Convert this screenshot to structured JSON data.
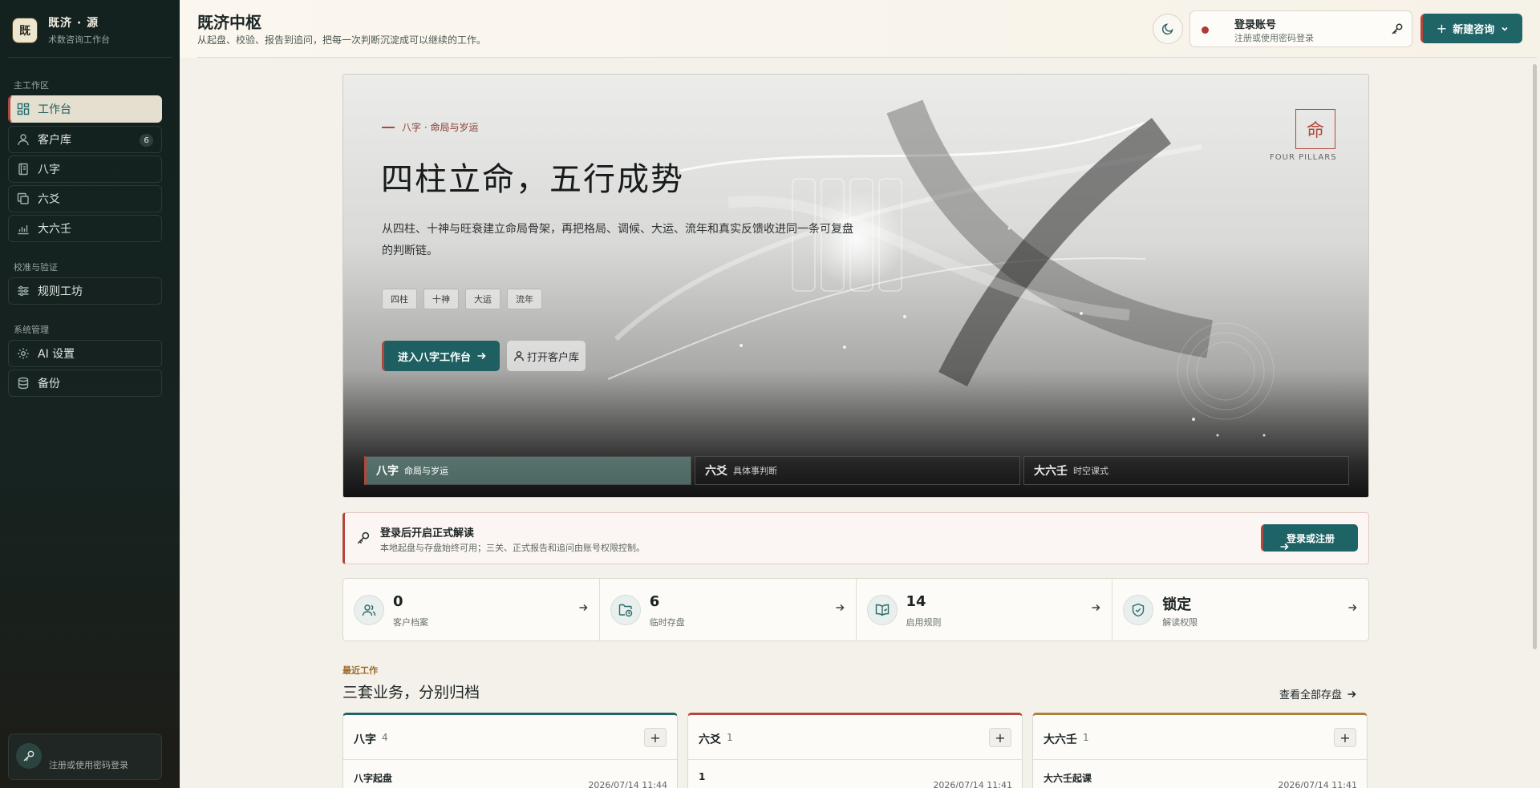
{
  "brand": {
    "logo_char": "既",
    "title": "既济 · 源",
    "subtitle": "术数咨询工作台"
  },
  "sidebar": {
    "sections": [
      {
        "label": "主工作区"
      },
      {
        "label": "校准与验证"
      },
      {
        "label": "系统管理"
      }
    ],
    "items": [
      {
        "label": "工作台",
        "icon": "dashboard-icon"
      },
      {
        "label": "客户库",
        "icon": "user-icon",
        "badge": "6"
      },
      {
        "label": "八字",
        "icon": "book-icon"
      },
      {
        "label": "六爻",
        "icon": "copy-icon"
      },
      {
        "label": "大六壬",
        "icon": "chart-icon"
      },
      {
        "label": "规则工坊",
        "icon": "sliders-icon"
      },
      {
        "label": "AI 设置",
        "icon": "gear-icon"
      },
      {
        "label": "备份",
        "icon": "database-icon"
      }
    ],
    "login_hint": "注册或使用密码登录"
  },
  "header": {
    "title": "既济中枢",
    "subtitle": "从起盘、校验、报告到追问，把每一次判断沉淀成可以继续的工作。",
    "account_title": "登录账号",
    "account_sub": "注册或使用密码登录",
    "new_button": "新建咨询",
    "new_button_plus": "+"
  },
  "hero": {
    "tag": "八字 · 命局与岁运",
    "title": "四柱立命，五行成势",
    "description": "从四柱、十神与旺衰建立命局骨架，再把格局、调候、大运、流年和真实反馈收进同一条可复盘的判断链。",
    "chips": [
      "四柱",
      "十神",
      "大运",
      "流年"
    ],
    "primary_button": "进入八字工作台",
    "secondary_button": "打开客户库",
    "seal_char": "命",
    "seal_caption": "FOUR PILLARS",
    "tabs": [
      {
        "big": "八字",
        "small": "命局与岁运"
      },
      {
        "big": "六爻",
        "small": "具体事判断"
      },
      {
        "big": "大六壬",
        "small": "时空课式"
      }
    ]
  },
  "banner": {
    "title": "登录后开启正式解读",
    "subtitle": "本地起盘与存盘始终可用；三关、正式报告和追问由账号权限控制。",
    "button": "登录或注册"
  },
  "stats": [
    {
      "value": "0",
      "label": "客户档案",
      "icon": "users-icon"
    },
    {
      "value": "6",
      "label": "临时存盘",
      "icon": "folder-clock-icon"
    },
    {
      "value": "14",
      "label": "启用规则",
      "icon": "book-open-icon"
    },
    {
      "value": "锁定",
      "label": "解读权限",
      "icon": "shield-check-icon"
    }
  ],
  "recent": {
    "kicker": "最近工作",
    "title": "三套业务，分别归档",
    "view_all": "查看全部存盘",
    "columns": [
      {
        "name": "八字",
        "count": "4",
        "item": "八字起盘",
        "time": "2026/07/14 11:44",
        "accent": "#1f6467"
      },
      {
        "name": "六爻",
        "count": "1",
        "item": "1",
        "time": "2026/07/14 11:41",
        "accent": "#b2473c"
      },
      {
        "name": "大六壬",
        "count": "1",
        "item": "大六壬起课",
        "time": "2026/07/14 11:41",
        "accent": "#a9823c"
      }
    ]
  },
  "colors": {
    "teal": "#1f6467",
    "red_accent": "#b2473c",
    "gold": "#a9823c",
    "sidebar_bg": "#13211f"
  }
}
